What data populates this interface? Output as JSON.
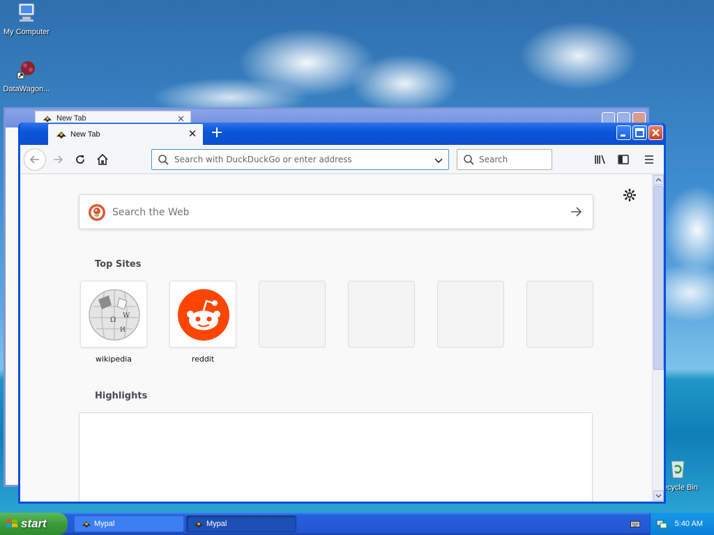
{
  "desktop": {
    "icons": [
      {
        "label": "My Computer"
      },
      {
        "label": "DataWagon..."
      },
      {
        "label": "Recycle Bin"
      }
    ]
  },
  "back_window": {
    "tab_title": "New Tab"
  },
  "browser": {
    "tab_title": "New Tab",
    "url_placeholder": "Search with DuckDuckGo or enter address",
    "search_placeholder": "Search",
    "web_search_placeholder": "Search the Web",
    "top_sites_title": "Top Sites",
    "top_sites": [
      {
        "label": "wikipedia",
        "icon": "wikipedia-globe-icon"
      },
      {
        "label": "reddit",
        "icon": "reddit-alien-icon"
      },
      {
        "label": ""
      },
      {
        "label": ""
      },
      {
        "label": ""
      },
      {
        "label": ""
      }
    ],
    "highlights_title": "Highlights",
    "colors": {
      "titlebar": "#0b4fd2",
      "reddit": "#ff4500",
      "url_focus": "#4a90d9"
    }
  },
  "taskbar": {
    "start_label": "start",
    "tasks": [
      {
        "label": "Mypal"
      },
      {
        "label": "Mypal"
      }
    ],
    "clock": "5:40 AM"
  }
}
